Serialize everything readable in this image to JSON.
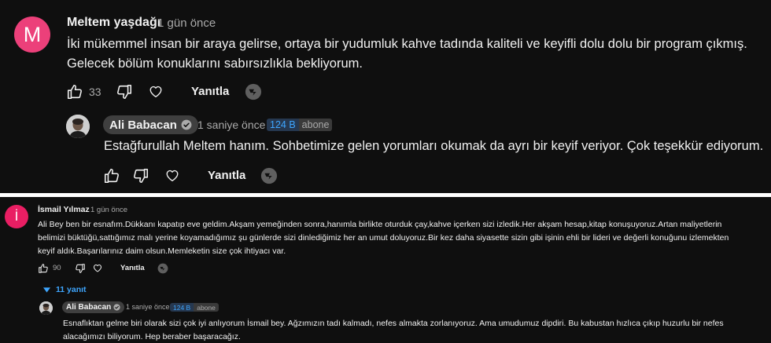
{
  "comment1": {
    "avatar_letter": "M",
    "avatar_color": "#ec407a",
    "author": "Meltem yaşdağı",
    "time": "1 gün önce",
    "text_line1": "İki mükemmel insan bir araya gelirse, ortaya bir yudumluk kahve tadında kaliteli ve keyifli dolu dolu bir program çıkmış.",
    "text_line2": "Gelecek bölüm konuklarını sabırsızlıkla bekliyorum.",
    "like_count": "33",
    "reply_label": "Yanıtla",
    "reply": {
      "author": "Ali Babacan",
      "time": "1 saniye önce",
      "subscribers": "124 B",
      "subscribers_label": "abone",
      "text": "Estağfurullah Meltem hanım. Sohbetimize gelen yorumları okumak da ayrı bir keyif veriyor. Çok teşekkür ediyorum.",
      "reply_label": "Yanıtla"
    }
  },
  "comment2": {
    "avatar_letter": "İ",
    "avatar_color": "#e91e63",
    "author": "İsmail Yılmaz",
    "time": "1 gün önce",
    "text_line1": "Ali Bey ben bir esnafım.Dükkanı kapatıp eve geldim.Akşam yemeğinden sonra,hanımla birlikte oturduk çay,kahve içerken sizi izledik.Her akşam hesap,kitap konuşuyoruz.Artan maliyetlerin",
    "text_line2": "belimizi büktüğü,sattığımız malı yerine koyamadığımız şu günlerde sizi dinlediğimiz her an umut doluyoruz.Bir kez daha siyasette sizin gibi işinin ehli bir lideri ve değerli konuğunu izlemekten",
    "text_line3": "keyif aldık.Başarılarınız daim olsun.Memleketin size çok ihtiyacı var.",
    "like_count": "90",
    "reply_label": "Yanıtla",
    "replies_toggle": "11 yanıt",
    "reply": {
      "author": "Ali Babacan",
      "time": "1 saniye önce",
      "subscribers": "124 B",
      "subscribers_label": "abone",
      "text_line1": "Esnaflıktan gelme biri olarak sizi çok iyi anlıyorum İsmail bey. Ağzımızın tadı kalmadı, nefes almakta zorlanıyoruz. Ama umudumuz dipdiri. Bu kabustan hızlıca çıkıp huzurlu bir nefes",
      "text_line2": "alacağımızı biliyorum. Hep beraber başaracağız."
    }
  },
  "icons": [
    "thumb-up-icon",
    "thumb-down-icon",
    "heart-icon",
    "thanks-icon",
    "verified-icon",
    "chevron-down-icon"
  ],
  "colors": {
    "background": "#0f0f0f",
    "link": "#3ea6ff",
    "muted": "#aaaaaa"
  }
}
